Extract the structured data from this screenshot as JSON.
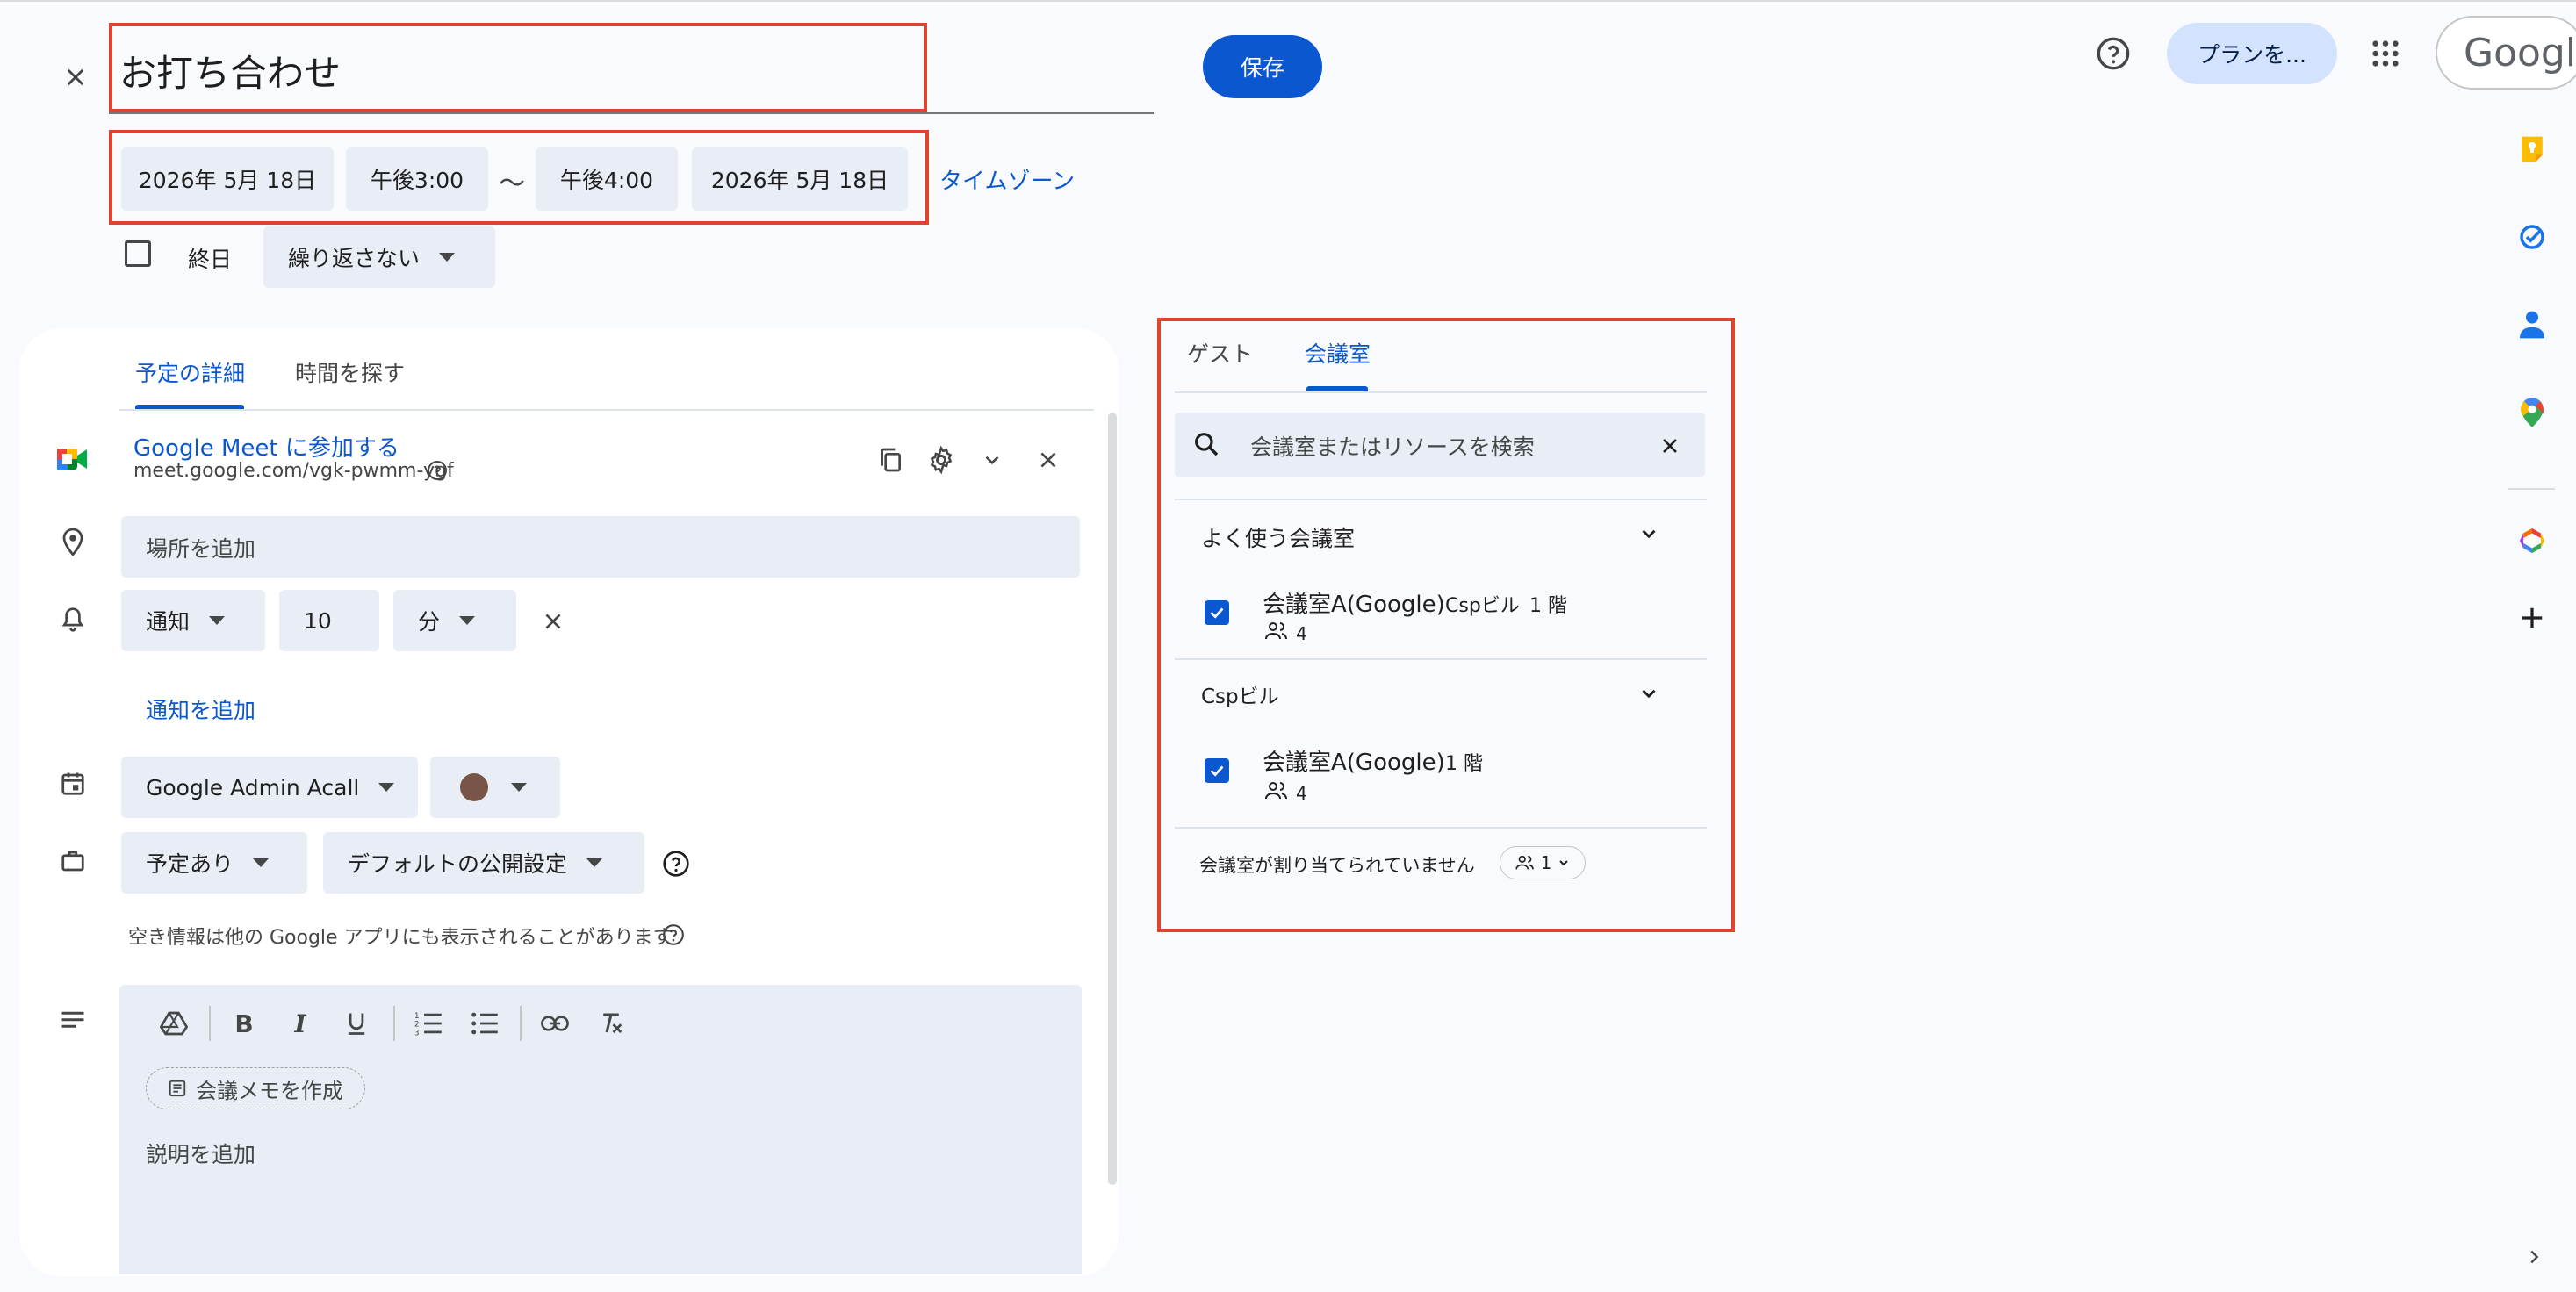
{
  "header": {
    "title": "お打ち合わせ",
    "save_label": "保存",
    "plan_label": "プランを...",
    "logo_text": "Google"
  },
  "datetime": {
    "start_date": "2026年 5月 18日",
    "start_time": "午後3:00",
    "separator": "〜",
    "end_time": "午後4:00",
    "end_date": "2026年 5月 18日",
    "timezone_label": "タイムゾーン",
    "all_day_label": "終日",
    "all_day_checked": false,
    "repeat_label": "繰り返さない"
  },
  "tabs": {
    "details": "予定の詳細",
    "find_time": "時間を探す"
  },
  "meet": {
    "join_label": "Google Meet に参加する",
    "url": "meet.google.com/vgk-pwmm-ygf"
  },
  "location": {
    "placeholder": "場所を追加"
  },
  "notification": {
    "type": "通知",
    "value": "10",
    "unit": "分",
    "add_label": "通知を追加"
  },
  "calendar": {
    "name": "Google Admin Acall",
    "color": "#795548"
  },
  "availability": {
    "status": "予定あり",
    "visibility": "デフォルトの公開設定",
    "note": "空き情報は他の Google アプリにも表示されることがあります"
  },
  "description": {
    "memo_label": "会議メモを作成",
    "placeholder": "説明を追加"
  },
  "right_panel": {
    "tab_guests": "ゲスト",
    "tab_rooms": "会議室",
    "search_placeholder": "会議室またはリソースを検索",
    "frequent": {
      "title": "よく使う会議室",
      "room": {
        "name": "会議室A(Google)",
        "building": "Cspビル",
        "floor": "1 階",
        "capacity": "4",
        "checked": true
      }
    },
    "building": {
      "title": "Cspビル",
      "room": {
        "name": "会議室A(Google)",
        "floor": "1 階",
        "capacity": "4",
        "checked": true
      }
    },
    "unassigned_label": "会議室が割り当てられていません",
    "unassigned_count": "1"
  },
  "colors": {
    "accent": "#0b57d0",
    "highlight_frame": "#e0442f",
    "chip_bg": "#e9eef6"
  }
}
